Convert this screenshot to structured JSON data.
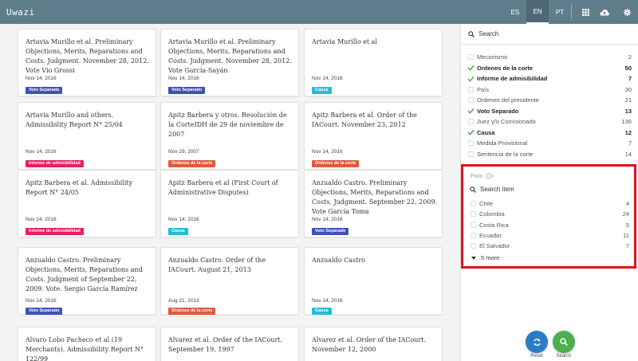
{
  "header": {
    "logo": "Uwazi",
    "languages": [
      "ES",
      "EN",
      "PT"
    ],
    "active_language": "EN",
    "icons": [
      "grid-icon",
      "cloud-upload-icon",
      "gear-icon"
    ]
  },
  "colors": {
    "header_bg": "#607d8b",
    "badge_voto_separado": "#3f51b5",
    "badge_informe": "#e91e63",
    "badge_causa": "#26bcd7",
    "badge_ordenes": "#e15a3c",
    "check_green": "#4caf50",
    "reset_fab": "#2a7cc7",
    "search_fab": "#4caf50",
    "highlight_border": "#e0141d"
  },
  "cards": [
    {
      "title": "Artavia Murillo et al. Preliminary Objections, Merits, Reparations and Costs. Judgment. November 28, 2012. Vote Vio Grossi",
      "date": "Nov 14, 2016",
      "badge": "Voto Separado",
      "badge_color": "#3f51b5"
    },
    {
      "title": "Artavia Murillo et al. Preliminary Objections, Merits, Reparations and Costs. Judgment. November 28, 2012. Vote García-Sayán",
      "date": "Nov 14, 2016",
      "badge": "Voto Separado",
      "badge_color": "#3f51b5"
    },
    {
      "title": "Artavia Murillo et al",
      "date": "Nov 14, 2016",
      "badge": "Causa",
      "badge_color": "#26bcd7"
    },
    {
      "title": "Artavia Murillo and others. Admissibility Report N° 25/04",
      "date": "Nov 14, 2016",
      "badge": "Informe de admisibilidad",
      "badge_color": "#e91e63"
    },
    {
      "title": "Apitz Barbera y otros. Resolución de la CorteIDH de 29 de noviembre de 2007",
      "date": "Nov 29, 2007",
      "badge": "Ordenes de la corte",
      "badge_color": "#e15a3c"
    },
    {
      "title": "Apitz Barbera et al. Order of the IACourt. November 23, 2012",
      "date": "Nov 14, 2016",
      "badge": "Ordenes de la corte",
      "badge_color": "#e15a3c"
    },
    {
      "title": "Apitz Barbera et al. Admissibility Report N° 24/05",
      "date": "Nov 14, 2016",
      "badge": "Informe de admisibilidad",
      "badge_color": "#e91e63"
    },
    {
      "title": "Apitz Barbera et al (First Court of Administrative Disputes)",
      "date": "Nov 14, 2016",
      "badge": "Causa",
      "badge_color": "#26bcd7"
    },
    {
      "title": "Anzualdo Castro. Preliminary Objections, Merits, Reparations and Costs. Judgment. September 22, 2009. Vote García Toma",
      "date": "Nov 14, 2016",
      "badge": "Voto Separado",
      "badge_color": "#3f51b5"
    },
    {
      "title": "Anzualdo Castro. Preliminary Objections, Merits, Reparations and Costs. Judgment of September 22, 2009. Vote. Sergio García Ramírez",
      "date": "Nov 14, 2016",
      "badge": "Voto Separado",
      "badge_color": "#3f51b5"
    },
    {
      "title": "Anzualdo Castro. Order of the IACourt. August 21, 2013",
      "date": "Aug 21, 2013",
      "badge": "Ordenes de la corte",
      "badge_color": "#e15a3c"
    },
    {
      "title": "Anzualdo Castro",
      "date": "Nov 14, 2016",
      "badge": "Causa",
      "badge_color": "#26bcd7"
    },
    {
      "title": "Alvaro Lobo Pacheco et al (19 Merchants). Admissibility Report N° 122/99",
      "date": "",
      "badge": "",
      "badge_color": ""
    },
    {
      "title": "Alvarez et al. Order of the IACourt. September 19, 1997",
      "date": "",
      "badge": "",
      "badge_color": ""
    },
    {
      "title": "Alvarez et al. Order of the IACourt. November 12, 2000",
      "date": "",
      "badge": "",
      "badge_color": ""
    }
  ],
  "sidebar": {
    "search_label": "Search",
    "types": [
      {
        "name": "Mecanismo",
        "count": "2",
        "selected": false
      },
      {
        "name": "Ordenes de la corte",
        "count": "50",
        "selected": true
      },
      {
        "name": "Informe de admisibilidad",
        "count": "7",
        "selected": true
      },
      {
        "name": "País",
        "count": "30",
        "selected": false
      },
      {
        "name": "Ordenes del presidente",
        "count": "21",
        "selected": false
      },
      {
        "name": "Voto Separado",
        "count": "13",
        "selected": true
      },
      {
        "name": "Juez y/o Comisionado",
        "count": "136",
        "selected": false
      },
      {
        "name": "Causa",
        "count": "12",
        "selected": true
      },
      {
        "name": "Medida Provisional",
        "count": "7",
        "selected": false
      },
      {
        "name": "Sentencia de la corte",
        "count": "14",
        "selected": false
      }
    ],
    "pais": {
      "title": "País",
      "search_label": "Search item",
      "items": [
        {
          "name": "Chile",
          "count": "4"
        },
        {
          "name": "Colombia",
          "count": "24"
        },
        {
          "name": "Costa Rica",
          "count": "5"
        },
        {
          "name": "Ecuador",
          "count": "11"
        },
        {
          "name": "El Salvador",
          "count": "7"
        }
      ],
      "more_label": "5 more"
    }
  },
  "actions": {
    "reset_label": "Reset",
    "search_label": "Search"
  }
}
